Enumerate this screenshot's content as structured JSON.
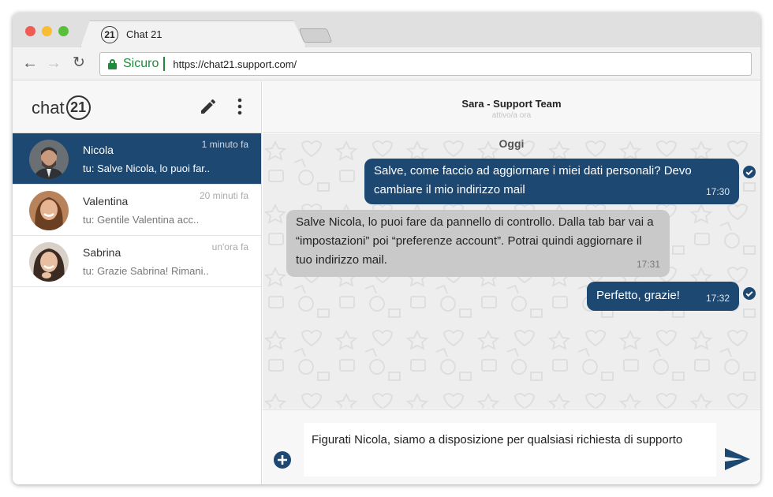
{
  "browser": {
    "tab_title": "Chat 21",
    "tab_icon_text": "21",
    "secure_label": "Sicuro",
    "url": "https://chat21.support.com/"
  },
  "sidebar": {
    "logo_text": "chat",
    "logo_badge": "21",
    "conversations": [
      {
        "name": "Nicola",
        "time": "1 minuto fa",
        "preview": "tu: Salve Nicola, lo puoi far..",
        "active": true
      },
      {
        "name": "Valentina",
        "time": "20 minuti fa",
        "preview": "tu: Gentile Valentina acc..",
        "active": false
      },
      {
        "name": "Sabrina",
        "time": "un'ora fa",
        "preview": "tu: Grazie Sabrina! Rimani..",
        "active": false
      }
    ]
  },
  "chat": {
    "title": "Sara - Support Team",
    "status": "attivo/a ora",
    "day_label": "Oggi",
    "messages": [
      {
        "direction": "out",
        "text": "Salve, come faccio ad aggiornare i miei dati personali? Devo cambiare il mio indirizzo mail",
        "time": "17:30"
      },
      {
        "direction": "in",
        "text": "Salve Nicola, lo puoi fare da pannello di controllo. Dalla tab bar vai a “impostazioni” poi “preferenze account”.  Potrai quindi aggiornare il tuo indirizzo mail.",
        "time": "17:31"
      },
      {
        "direction": "out",
        "text": "Perfetto, grazie!",
        "time": "17:32"
      }
    ],
    "composer_text": "Figurati Nicola, siamo a disposizione per qualsiasi richiesta di supporto"
  },
  "colors": {
    "accent": "#1c4872",
    "incoming_bubble": "#c9c9c9",
    "secure_green": "#1e8a3a"
  }
}
